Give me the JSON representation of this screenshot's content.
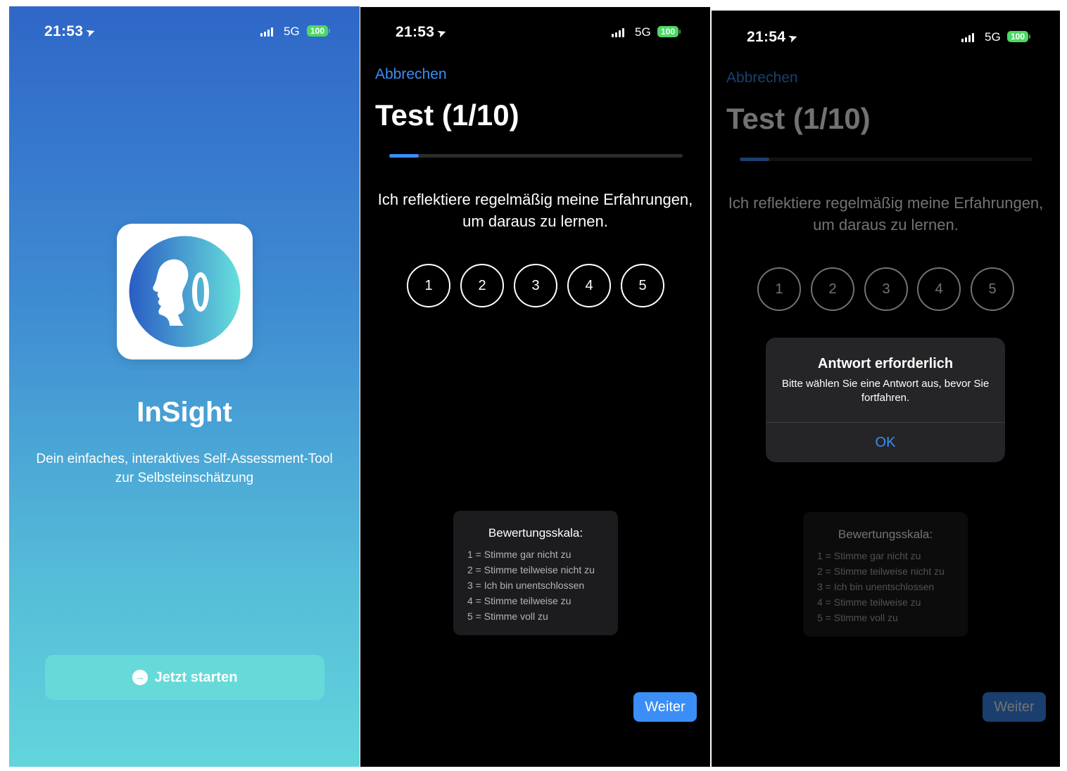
{
  "status": {
    "screen1_time": "21:53",
    "screen2_time": "21:53",
    "screen3_time": "21:54",
    "network": "5G",
    "battery": "100"
  },
  "welcome": {
    "app_name": "InSight",
    "tagline": "Dein einfaches, interaktives Self-Assessment-Tool zur Selbsteinschätzung",
    "start_button": "Jetzt starten",
    "start_icon": "arrow-right-circle-icon",
    "app_icon": "head-profile-mirror-icon"
  },
  "test": {
    "cancel_label": "Abbrechen",
    "title": "Test (1/10)",
    "progress": 0.1,
    "question": "Ich reflektiere regelmäßig meine Erfahrungen, um daraus zu lernen.",
    "options": [
      "1",
      "2",
      "3",
      "4",
      "5"
    ],
    "scale_title": "Bewertungsskala:",
    "scale_items": [
      "1 = Stimme gar nicht zu",
      "2 = Stimme teilweise nicht zu",
      "3 = Ich bin unentschlossen",
      "4 = Stimme teilweise zu",
      "5 = Stimme voll zu"
    ],
    "next_label": "Weiter"
  },
  "alert": {
    "title": "Antwort erforderlich",
    "message": "Bitte wählen Sie eine Antwort aus, bevor Sie fortfahren.",
    "ok_label": "OK"
  },
  "colors": {
    "accent": "#3a8ef6",
    "gradient_top": "#2f67c8",
    "gradient_bottom": "#62d5dc",
    "button_teal": "#66dad9",
    "battery_green": "#4cd964"
  }
}
